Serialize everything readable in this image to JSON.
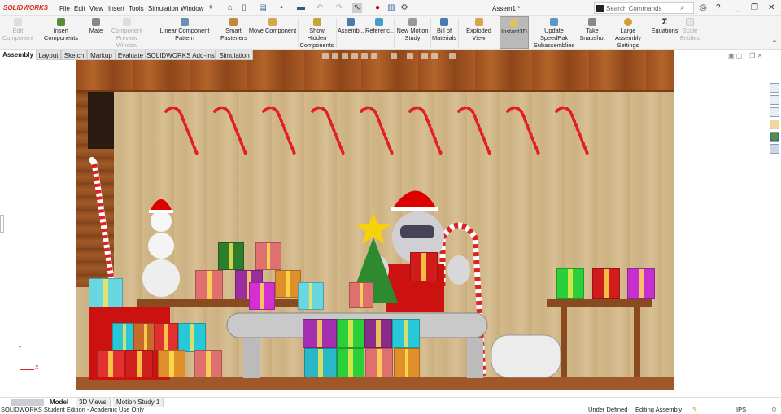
{
  "app": {
    "logo": "SOLIDWORKS",
    "title": "Assem1 *"
  },
  "menu": [
    "File",
    "Edit",
    "View",
    "Insert",
    "Tools",
    "Simulation",
    "Window"
  ],
  "search": {
    "placeholder": "Search Commands"
  },
  "ribbon": [
    {
      "label": "Edit Component",
      "disabled": true
    },
    {
      "label": "Insert Components"
    },
    {
      "label": "Mate"
    },
    {
      "label": "Component Preview Window",
      "disabled": true
    },
    {
      "label": "Linear Component Pattern"
    },
    {
      "label": "Smart Fasteners"
    },
    {
      "label": "Move Component"
    },
    {
      "label": "Show Hidden Components"
    },
    {
      "label": "Assemb..."
    },
    {
      "label": "Referenc..."
    },
    {
      "label": "New Motion Study"
    },
    {
      "label": "Bill of Materials"
    },
    {
      "label": "Exploded View"
    },
    {
      "label": "Instant3D",
      "active": true
    },
    {
      "label": "Update SpeedPak Subassemblies"
    },
    {
      "label": "Take Snapshot"
    },
    {
      "label": "Large Assembly Settings"
    },
    {
      "label": "Equations"
    },
    {
      "label": "Scale Entities",
      "disabled": true
    }
  ],
  "tabs": [
    "Assembly",
    "Layout",
    "Sketch",
    "Markup",
    "Evaluate",
    "SOLIDWORKS Add-Ins",
    "Simulation"
  ],
  "bottom_tabs": [
    "Model",
    "3D Views",
    "Motion Study 1"
  ],
  "status": {
    "left": "SOLIDWORKS Student Edition - Academic Use Only",
    "state": "Under Defined",
    "mode": "Editing Assembly",
    "units": "IPS"
  },
  "axes": {
    "x": "X",
    "y": "Y"
  },
  "colors": {
    "accent": "#d52b1e",
    "wood": "#d3b98a",
    "active_tool": "#b9b9b9"
  }
}
